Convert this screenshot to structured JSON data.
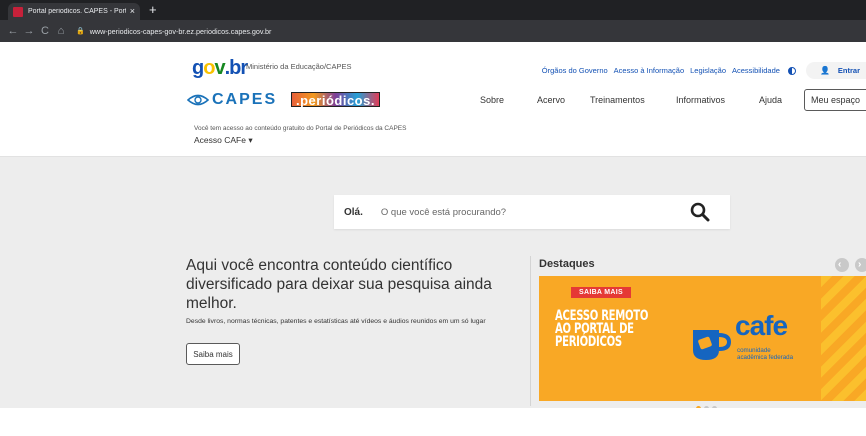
{
  "browser": {
    "tab_title": "Portal periodicos. CAPES - Portal",
    "tab_close": "×",
    "new_tab": "+",
    "back": "←",
    "forward": "→",
    "reload": "C",
    "home": "⌂",
    "url": "www-periodicos-capes-gov-br.ez.periodicos.capes.gov.br"
  },
  "govbr": {
    "logo_parts": [
      "g",
      "o",
      "v",
      ".br"
    ],
    "ministry": "Ministério da Educação/CAPES",
    "links": [
      "Órgãos do Governo",
      "Acesso à Informação",
      "Legislação",
      "Acessibilidade"
    ],
    "login": "Entrar"
  },
  "brand": {
    "capes": "CAPES",
    "periodicos": ".periódicos."
  },
  "nav": {
    "items": [
      "Sobre",
      "Acervo",
      "Treinamentos",
      "Informativos",
      "Ajuda"
    ],
    "meu_espaco": "Meu espaço"
  },
  "access": {
    "note": "Você tem acesso ao conteúdo gratuito do Portal de Periódicos da CAPES",
    "cafe_link": "Acesso CAFe ▾"
  },
  "search": {
    "greeting": "Olá.",
    "placeholder": "O que você está procurando?"
  },
  "hero": {
    "title": "Aqui você encontra conteúdo científico diversificado para deixar sua pesquisa ainda melhor.",
    "description": "Desde livros, normas técnicas, patentes e estatísticas até vídeos e áudios reunidos em um só lugar",
    "button": "Saiba mais"
  },
  "destaques": {
    "title": "Destaques",
    "arrow_prev": "‹",
    "arrow_next": "›",
    "banner": {
      "tag": "SAIBA MAIS",
      "headline_lines": [
        "ACESSO REMOTO",
        "AO PORTAL DE",
        "PERIÓDICOS"
      ],
      "cafe_word": "cafe",
      "cafe_sub_lines": [
        "comunidade",
        "acadêmica federada"
      ]
    },
    "slides": 3,
    "active_slide": 0
  },
  "colors": {
    "gov_blue": "#1351b4",
    "banner_orange": "#f9a825",
    "tag_red": "#e53935",
    "cafe_blue": "#1565c0"
  }
}
